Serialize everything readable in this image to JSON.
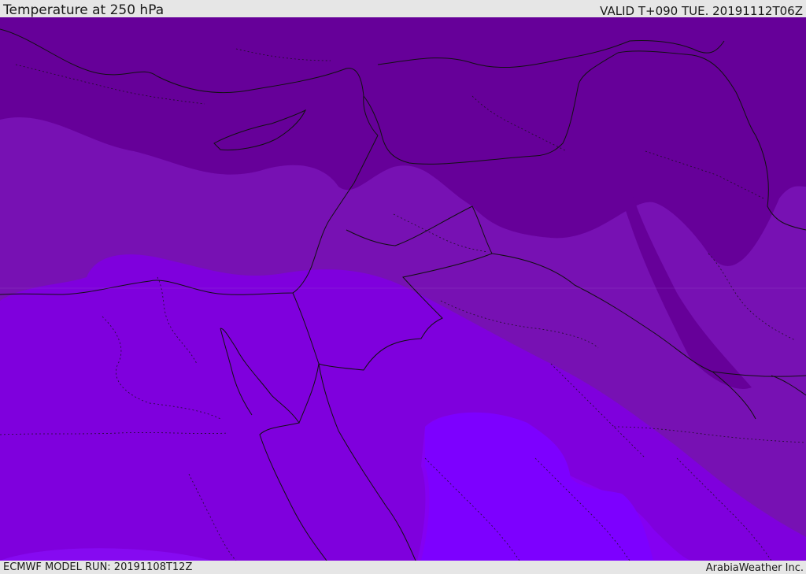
{
  "header": {
    "title": "Temperature at 250 hPa",
    "valid_time": "VALID T+090 TUE. 20191112T06Z"
  },
  "footer": {
    "model_run": "ECMWF MODEL RUN: 20191108T12Z",
    "credit": "ArabiaWeather Inc."
  },
  "map": {
    "field": "temperature",
    "level": "250 hPa",
    "colors": {
      "band_darkest": "#660099",
      "band_dark": "#7711b3",
      "band_mid": "#7f00dd",
      "band_light": "#8400f2",
      "band_lightest": "#7d00ff",
      "borders": "#111111"
    }
  }
}
